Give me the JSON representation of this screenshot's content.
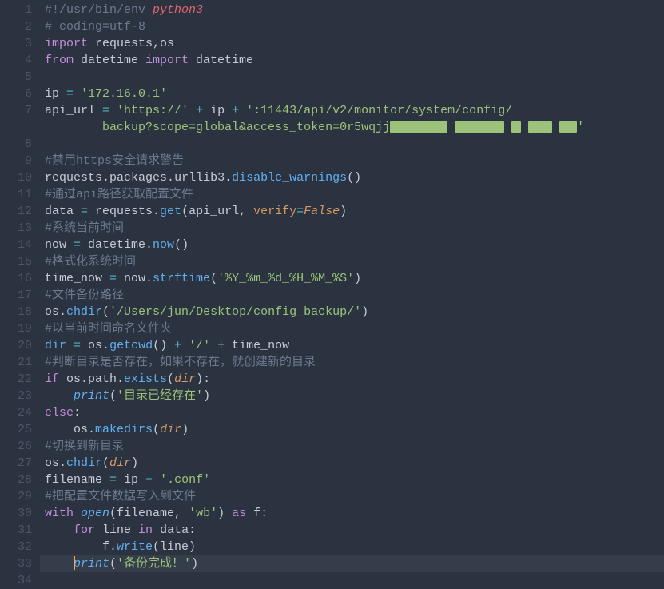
{
  "lines": [
    {
      "n": 1,
      "tokens": [
        {
          "c": "tk-comment",
          "t": "#!/usr/bin/env "
        },
        {
          "c": "tk-redit",
          "t": "python3"
        }
      ]
    },
    {
      "n": 2,
      "tokens": [
        {
          "c": "tk-comment",
          "t": "# coding=utf-8"
        }
      ]
    },
    {
      "n": 3,
      "tokens": [
        {
          "c": "tk-keyword",
          "t": "import"
        },
        {
          "c": "tk-default",
          "t": " requests,os"
        }
      ]
    },
    {
      "n": 4,
      "tokens": [
        {
          "c": "tk-keyword",
          "t": "from"
        },
        {
          "c": "tk-default",
          "t": " datetime "
        },
        {
          "c": "tk-keyword",
          "t": "import"
        },
        {
          "c": "tk-default",
          "t": " datetime"
        }
      ]
    },
    {
      "n": 5,
      "tokens": []
    },
    {
      "n": 6,
      "tokens": [
        {
          "c": "tk-default",
          "t": "ip "
        },
        {
          "c": "tk-cyan",
          "t": "="
        },
        {
          "c": "tk-default",
          "t": " "
        },
        {
          "c": "tk-string",
          "t": "'172.16.0.1'"
        }
      ]
    },
    {
      "n": 7,
      "tokens": [
        {
          "c": "tk-default",
          "t": "api_url "
        },
        {
          "c": "tk-cyan",
          "t": "="
        },
        {
          "c": "tk-default",
          "t": " "
        },
        {
          "c": "tk-string",
          "t": "'https://'"
        },
        {
          "c": "tk-default",
          "t": " "
        },
        {
          "c": "tk-cyan",
          "t": "+"
        },
        {
          "c": "tk-default",
          "t": " ip "
        },
        {
          "c": "tk-cyan",
          "t": "+"
        },
        {
          "c": "tk-default",
          "t": " "
        },
        {
          "c": "tk-string",
          "t": "':11443/api/v2/monitor/system/config/"
        }
      ]
    },
    {
      "n": "",
      "cont": true,
      "tokens": [
        {
          "c": "tk-string",
          "t": "    backup?scope=global&access_token=0r5wqjj"
        },
        {
          "c": "",
          "t": "",
          "red": 72
        },
        {
          "c": "tk-default",
          "t": " "
        },
        {
          "c": "",
          "t": "",
          "red": 62
        },
        {
          "c": "tk-default",
          "t": " "
        },
        {
          "c": "",
          "t": "",
          "red": 12
        },
        {
          "c": "tk-default",
          "t": " "
        },
        {
          "c": "",
          "t": "",
          "red": 30
        },
        {
          "c": "tk-default",
          "t": " "
        },
        {
          "c": "",
          "t": "",
          "red": 22
        },
        {
          "c": "tk-string",
          "t": "'"
        }
      ]
    },
    {
      "n": 8,
      "tokens": []
    },
    {
      "n": 9,
      "tokens": [
        {
          "c": "tk-comment",
          "t": "#禁用https安全请求警告"
        }
      ]
    },
    {
      "n": 10,
      "tokens": [
        {
          "c": "tk-default",
          "t": "requests"
        },
        {
          "c": "tk-default",
          "t": "."
        },
        {
          "c": "tk-default",
          "t": "packages"
        },
        {
          "c": "tk-default",
          "t": "."
        },
        {
          "c": "tk-default",
          "t": "urllib3"
        },
        {
          "c": "tk-default",
          "t": "."
        },
        {
          "c": "tk-func",
          "t": "disable_warnings"
        },
        {
          "c": "tk-default",
          "t": "()"
        }
      ]
    },
    {
      "n": 11,
      "tokens": [
        {
          "c": "tk-comment",
          "t": "#通过api路径获取配置文件"
        }
      ]
    },
    {
      "n": 12,
      "tokens": [
        {
          "c": "tk-default",
          "t": "data "
        },
        {
          "c": "tk-cyan",
          "t": "="
        },
        {
          "c": "tk-default",
          "t": " requests."
        },
        {
          "c": "tk-func",
          "t": "get"
        },
        {
          "c": "tk-default",
          "t": "(api_url, "
        },
        {
          "c": "tk-kwarg",
          "t": "verify"
        },
        {
          "c": "tk-cyan",
          "t": "="
        },
        {
          "c": "tk-kwval",
          "t": "False"
        },
        {
          "c": "tk-default",
          "t": ")"
        }
      ]
    },
    {
      "n": 13,
      "tokens": [
        {
          "c": "tk-comment",
          "t": "#系统当前时间"
        }
      ]
    },
    {
      "n": 14,
      "tokens": [
        {
          "c": "tk-default",
          "t": "now "
        },
        {
          "c": "tk-cyan",
          "t": "="
        },
        {
          "c": "tk-default",
          "t": " datetime."
        },
        {
          "c": "tk-func",
          "t": "now"
        },
        {
          "c": "tk-default",
          "t": "()"
        }
      ]
    },
    {
      "n": 15,
      "tokens": [
        {
          "c": "tk-comment",
          "t": "#格式化系统时间"
        }
      ]
    },
    {
      "n": 16,
      "tokens": [
        {
          "c": "tk-default",
          "t": "time_now "
        },
        {
          "c": "tk-cyan",
          "t": "="
        },
        {
          "c": "tk-default",
          "t": " now."
        },
        {
          "c": "tk-func",
          "t": "strftime"
        },
        {
          "c": "tk-default",
          "t": "("
        },
        {
          "c": "tk-string",
          "t": "'%Y_%m_%d_%H_%M_%S'"
        },
        {
          "c": "tk-default",
          "t": ")"
        }
      ]
    },
    {
      "n": 17,
      "tokens": [
        {
          "c": "tk-comment",
          "t": "#文件备份路径"
        }
      ]
    },
    {
      "n": 18,
      "tokens": [
        {
          "c": "tk-default",
          "t": "os."
        },
        {
          "c": "tk-func",
          "t": "chdir"
        },
        {
          "c": "tk-default",
          "t": "("
        },
        {
          "c": "tk-string",
          "t": "'/Users/jun/Desktop/config_backup/'"
        },
        {
          "c": "tk-default",
          "t": ")"
        }
      ]
    },
    {
      "n": 19,
      "tokens": [
        {
          "c": "tk-comment",
          "t": "#以当前时间命名文件夹"
        }
      ]
    },
    {
      "n": 20,
      "tokens": [
        {
          "c": "tk-builtin",
          "t": "dir"
        },
        {
          "c": "tk-default",
          "t": " "
        },
        {
          "c": "tk-cyan",
          "t": "="
        },
        {
          "c": "tk-default",
          "t": " os."
        },
        {
          "c": "tk-func",
          "t": "getcwd"
        },
        {
          "c": "tk-default",
          "t": "() "
        },
        {
          "c": "tk-cyan",
          "t": "+"
        },
        {
          "c": "tk-default",
          "t": " "
        },
        {
          "c": "tk-string",
          "t": "'/'"
        },
        {
          "c": "tk-default",
          "t": " "
        },
        {
          "c": "tk-cyan",
          "t": "+"
        },
        {
          "c": "tk-default",
          "t": " time_now"
        }
      ]
    },
    {
      "n": 21,
      "tokens": [
        {
          "c": "tk-comment",
          "t": "#判断目录是否存在，如果不存在，就创建新的目录"
        }
      ]
    },
    {
      "n": 22,
      "tokens": [
        {
          "c": "tk-keyword",
          "t": "if"
        },
        {
          "c": "tk-default",
          "t": " os.path."
        },
        {
          "c": "tk-func",
          "t": "exists"
        },
        {
          "c": "tk-default",
          "t": "("
        },
        {
          "c": "tk-paramit",
          "t": "dir"
        },
        {
          "c": "tk-default",
          "t": "):"
        }
      ]
    },
    {
      "n": 23,
      "indent": 1,
      "tokens": [
        {
          "c": "tk-funcit",
          "t": "print"
        },
        {
          "c": "tk-default",
          "t": "("
        },
        {
          "c": "tk-string",
          "t": "'目录已经存在'"
        },
        {
          "c": "tk-default",
          "t": ")"
        }
      ]
    },
    {
      "n": 24,
      "tokens": [
        {
          "c": "tk-keyword",
          "t": "else"
        },
        {
          "c": "tk-default",
          "t": ":"
        }
      ]
    },
    {
      "n": 25,
      "indent": 1,
      "tokens": [
        {
          "c": "tk-default",
          "t": "os."
        },
        {
          "c": "tk-func",
          "t": "makedirs"
        },
        {
          "c": "tk-default",
          "t": "("
        },
        {
          "c": "tk-paramit",
          "t": "dir"
        },
        {
          "c": "tk-default",
          "t": ")"
        }
      ]
    },
    {
      "n": 26,
      "tokens": [
        {
          "c": "tk-comment",
          "t": "#切换到新目录"
        }
      ]
    },
    {
      "n": 27,
      "tokens": [
        {
          "c": "tk-default",
          "t": "os."
        },
        {
          "c": "tk-func",
          "t": "chdir"
        },
        {
          "c": "tk-default",
          "t": "("
        },
        {
          "c": "tk-paramit",
          "t": "dir"
        },
        {
          "c": "tk-default",
          "t": ")"
        }
      ]
    },
    {
      "n": 28,
      "tokens": [
        {
          "c": "tk-default",
          "t": "filename "
        },
        {
          "c": "tk-cyan",
          "t": "="
        },
        {
          "c": "tk-default",
          "t": " ip "
        },
        {
          "c": "tk-cyan",
          "t": "+"
        },
        {
          "c": "tk-default",
          "t": " "
        },
        {
          "c": "tk-string",
          "t": "'.conf'"
        }
      ]
    },
    {
      "n": 29,
      "tokens": [
        {
          "c": "tk-comment",
          "t": "#把配置文件数据写入到文件"
        }
      ]
    },
    {
      "n": 30,
      "tokens": [
        {
          "c": "tk-keyword",
          "t": "with"
        },
        {
          "c": "tk-default",
          "t": " "
        },
        {
          "c": "tk-funcit",
          "t": "open"
        },
        {
          "c": "tk-default",
          "t": "(filename, "
        },
        {
          "c": "tk-string",
          "t": "'wb'"
        },
        {
          "c": "tk-default",
          "t": ") "
        },
        {
          "c": "tk-keyword",
          "t": "as"
        },
        {
          "c": "tk-default",
          "t": " f:"
        }
      ]
    },
    {
      "n": 31,
      "indent": 1,
      "tokens": [
        {
          "c": "tk-keyword",
          "t": "for"
        },
        {
          "c": "tk-default",
          "t": " line "
        },
        {
          "c": "tk-keyword",
          "t": "in"
        },
        {
          "c": "tk-default",
          "t": " data:"
        }
      ]
    },
    {
      "n": 32,
      "indent": 2,
      "tokens": [
        {
          "c": "tk-default",
          "t": "f."
        },
        {
          "c": "tk-func",
          "t": "write"
        },
        {
          "c": "tk-default",
          "t": "(line)"
        }
      ]
    },
    {
      "n": 33,
      "hl": true,
      "cursor": true,
      "indent": 1,
      "tokens": [
        {
          "c": "tk-funcit",
          "t": "print"
        },
        {
          "c": "tk-default",
          "t": "("
        },
        {
          "c": "tk-string",
          "t": "'备份完成！'"
        },
        {
          "c": "tk-default",
          "t": ")"
        }
      ]
    },
    {
      "n": 34,
      "tokens": []
    }
  ]
}
